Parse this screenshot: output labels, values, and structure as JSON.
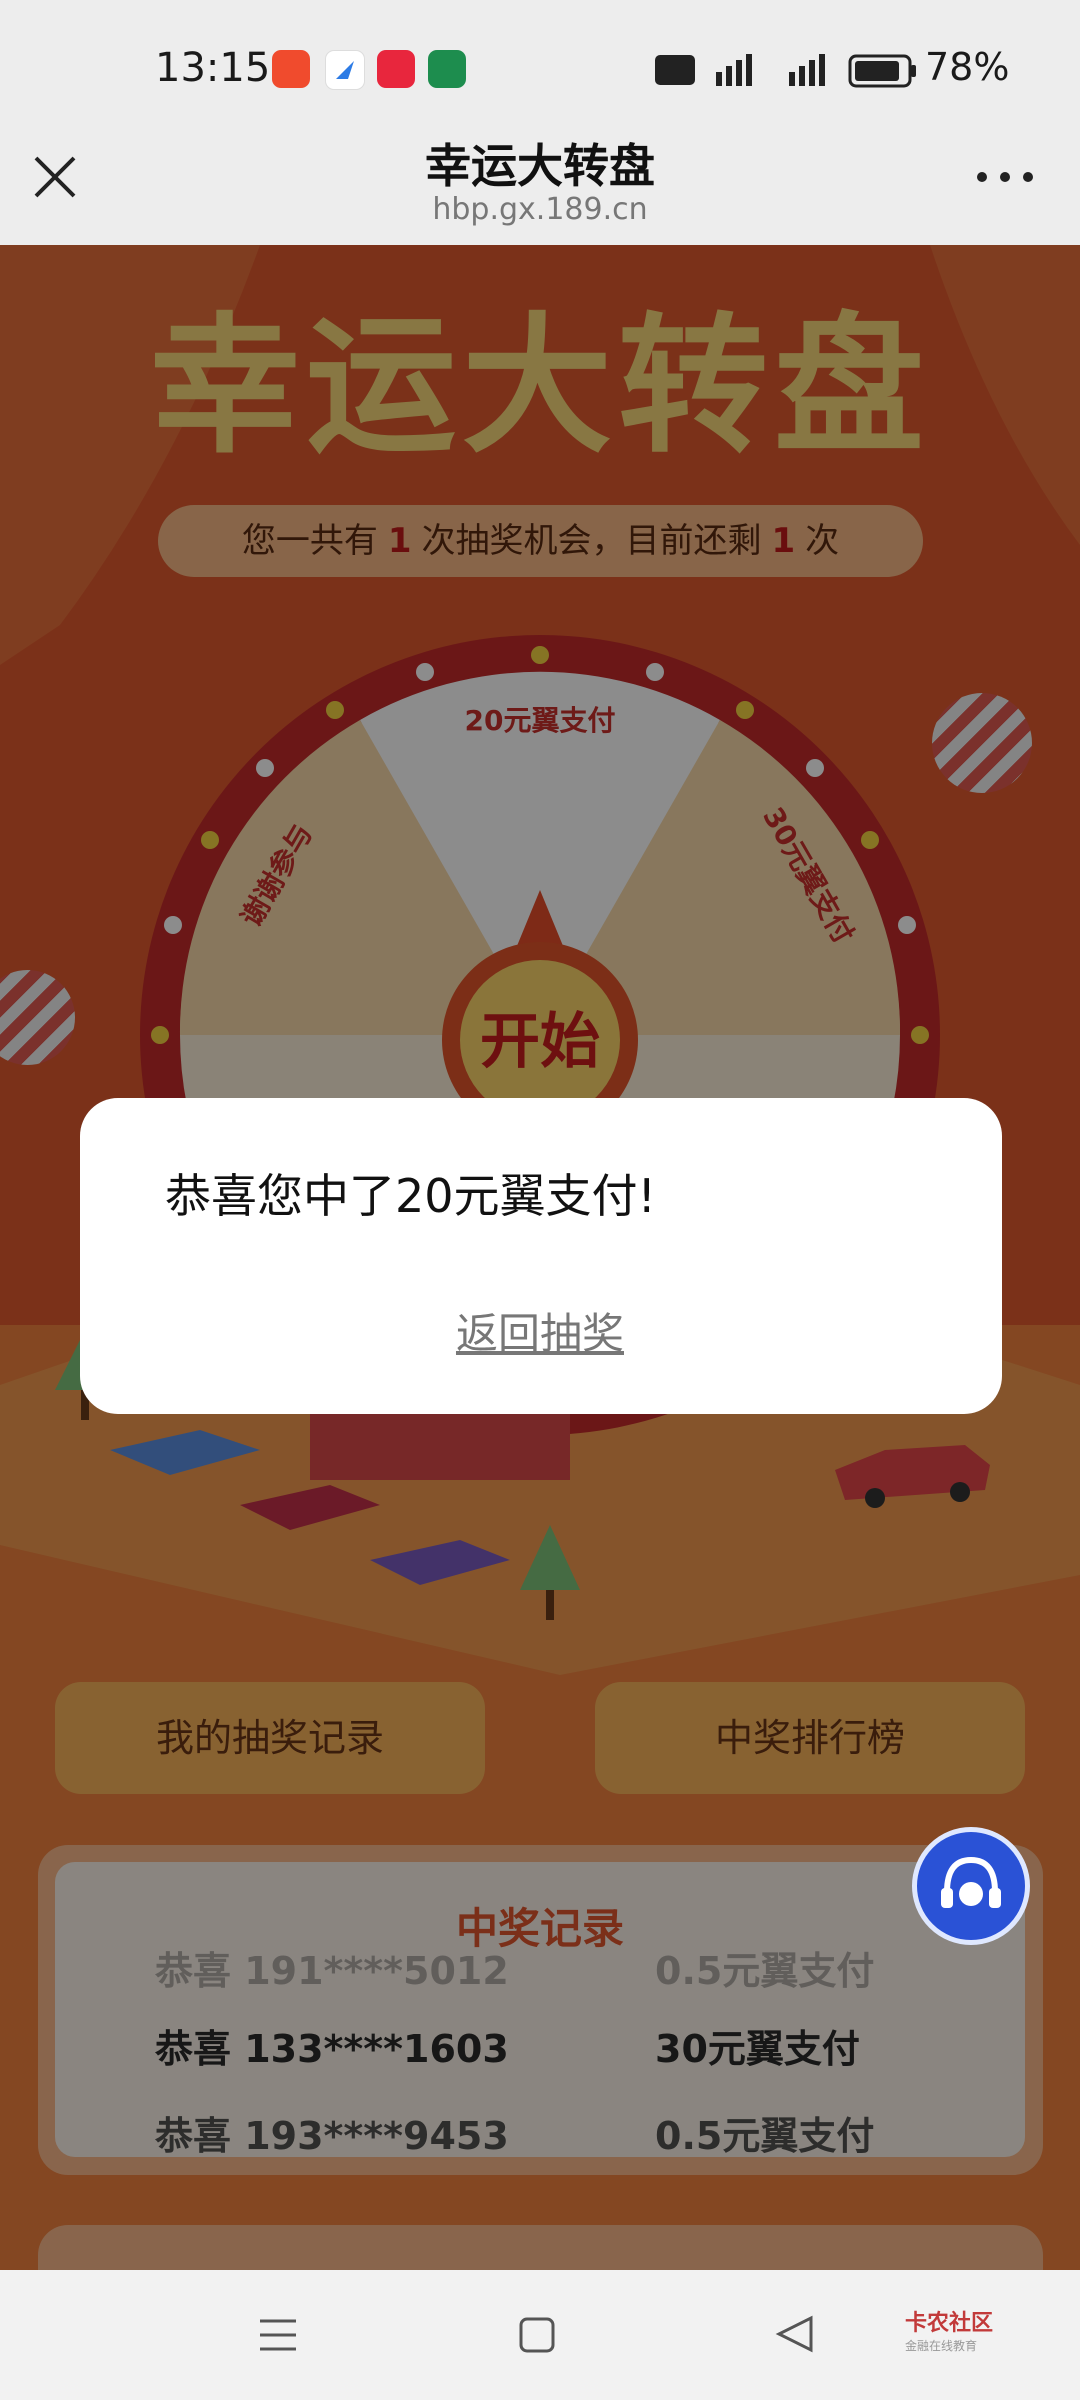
{
  "status_bar": {
    "time": "13:15",
    "battery_percent": "78%"
  },
  "header": {
    "title": "幸运大转盘",
    "url": "hbp.gx.189.cn"
  },
  "hero": {
    "title": "幸运大转盘",
    "chances_prefix": "您一共有",
    "chances_total": "1",
    "chances_mid": "次抽奖机会，目前还剩",
    "chances_left": "1",
    "chances_suffix": "次"
  },
  "wheel": {
    "segments": [
      "20元翼支付",
      "30元翼支付",
      "谢谢参与"
    ],
    "start_label": "开始"
  },
  "buttons": {
    "my_records": "我的抽奖记录",
    "leaderboard": "中奖排行榜"
  },
  "records": {
    "title": "中奖记录",
    "rows": [
      {
        "user": "恭喜 191****5012",
        "prize": "0.5元翼支付"
      },
      {
        "user": "恭喜 133****1603",
        "prize": "30元翼支付"
      },
      {
        "user": "恭喜 193****9453",
        "prize": "0.5元翼支付"
      }
    ]
  },
  "dialog": {
    "message": "恭喜您中了20元翼支付!",
    "return_link": "返回抽奖"
  },
  "watermark": {
    "name": "卡农社区",
    "tagline": "金融在线教育"
  }
}
